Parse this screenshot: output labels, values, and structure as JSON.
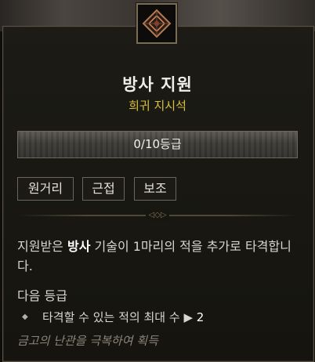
{
  "tooltip": {
    "icon": "skill-emblem-icon",
    "title": "방사 지원",
    "subtitle": "희귀 지시석",
    "rank": "0/10등급",
    "tags": [
      "원거리",
      "근접",
      "보조"
    ],
    "description": {
      "part1": "지원받은 ",
      "keyword": "방사",
      "part2": " 기술이 1마리의 적을 추가로 타격합니다."
    },
    "next_rank": {
      "label": "다음 등급",
      "stat_text": "타격할 수 있는 적의 최대 수",
      "arrow": "▶",
      "stat_value": "2"
    },
    "source": "금고의 난관을 극복하여 획득"
  },
  "colors": {
    "title": "#f0eee8",
    "subtitle": "#d8c13c",
    "border": "#5a5244",
    "source": "#8b8478"
  }
}
